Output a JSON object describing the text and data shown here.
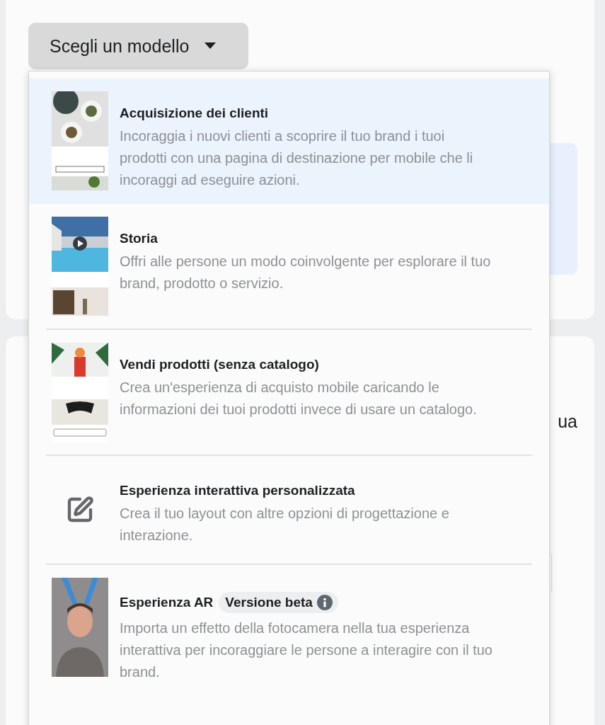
{
  "template_button": {
    "label": "Scegli un modello",
    "expanded": true
  },
  "background_text": "ua",
  "menu": {
    "items": [
      {
        "kind": "picture",
        "title": "Acquisizione dei clienti",
        "description": "Incoraggia i nuovi clienti a scoprire il tuo brand i tuoi prodotti con una pagina di destinazione per mobile che li incoraggi ad eseguire azioni.",
        "selected": true
      },
      {
        "kind": "picture",
        "title": "Storia",
        "description": "Offri alle persone un modo coinvolgente per esplorare il tuo brand, prodotto o servizio.",
        "selected": false
      },
      {
        "kind": "picture",
        "title": "Vendi prodotti (senza catalogo)",
        "description": "Crea un'esperienza di acquisto mobile caricando le informazioni dei tuoi prodotti invece di usare un catalogo.",
        "selected": false
      },
      {
        "kind": "icon",
        "title": "Esperienza interattiva personalizzata",
        "description": "Crea il tuo layout con altre opzioni di progettazione e interazione.",
        "selected": false
      },
      {
        "kind": "picture",
        "title": "Esperienza AR",
        "badge": "Versione beta",
        "description": "Importa un effetto della fotocamera nella tua esperienza interattiva per incoraggiare le persone a interagire con il tuo brand.",
        "selected": false
      }
    ]
  }
}
